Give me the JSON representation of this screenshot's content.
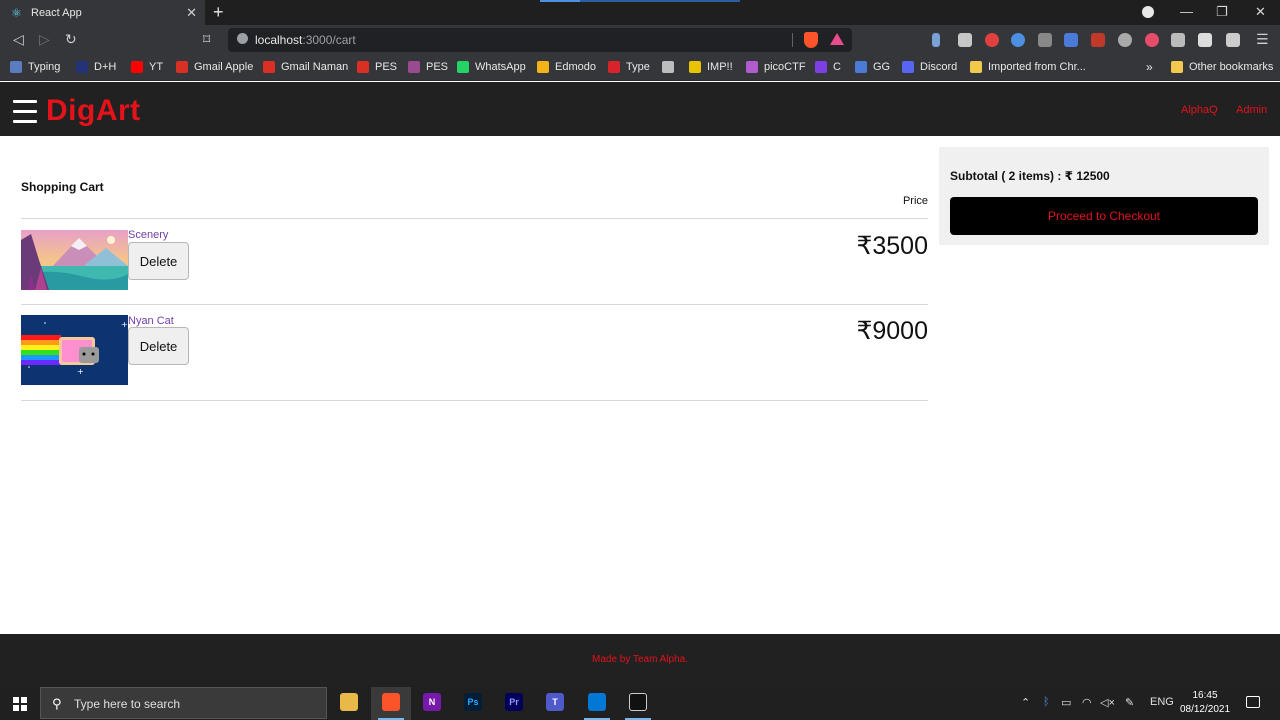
{
  "browser": {
    "tab_title": "React App",
    "url_host": "localhost",
    "url_path": ":3000/cart",
    "bookmarks": [
      {
        "label": "Typing",
        "color": "#5b7cbf"
      },
      {
        "label": "D+H",
        "color": "#223377"
      },
      {
        "label": "YT",
        "color": "#ff0000"
      },
      {
        "label": "Gmail Apple",
        "color": "#d93025"
      },
      {
        "label": "Gmail Naman",
        "color": "#d93025"
      },
      {
        "label": "PES",
        "color": "#d93025"
      },
      {
        "label": "PES",
        "color": "#9a4b8f"
      },
      {
        "label": "WhatsApp",
        "color": "#25d366"
      },
      {
        "label": "Edmodo",
        "color": "#f5b31a"
      },
      {
        "label": "Type",
        "color": "#d8232a"
      },
      {
        "label": "",
        "color": "#bdbdbd"
      },
      {
        "label": "IMP!!",
        "color": "#e8c400"
      },
      {
        "label": "picoCTF",
        "color": "#b05ccf"
      },
      {
        "label": "C",
        "color": "#7b3fe4"
      },
      {
        "label": "GG",
        "color": "#4a7bd6"
      },
      {
        "label": "Discord",
        "color": "#5865f2"
      },
      {
        "label": "Imported from Chr...",
        "color": "#f2c94c"
      }
    ],
    "more_bookmarks": "»",
    "other_bookmarks": "Other bookmarks"
  },
  "app": {
    "logo": "DigArt",
    "nav_links": [
      "AlphaQ",
      "Admin"
    ],
    "accent_color": "#e3121b"
  },
  "cart": {
    "heading": "Shopping Cart",
    "price_heading": "Price",
    "delete_label": "Delete",
    "items": [
      {
        "name": "Scenery",
        "price": "₹3500"
      },
      {
        "name": "Nyan Cat",
        "price": "₹9000"
      }
    ]
  },
  "summary": {
    "subtotal": "Subtotal ( 2 items) : ₹ 12500",
    "checkout_label": "Proceed to Checkout"
  },
  "footer": {
    "text": "Made by Team Alpha."
  },
  "taskbar": {
    "search_placeholder": "Type here to search",
    "language": "ENG",
    "time": "16:45",
    "date": "08/12/2021"
  }
}
